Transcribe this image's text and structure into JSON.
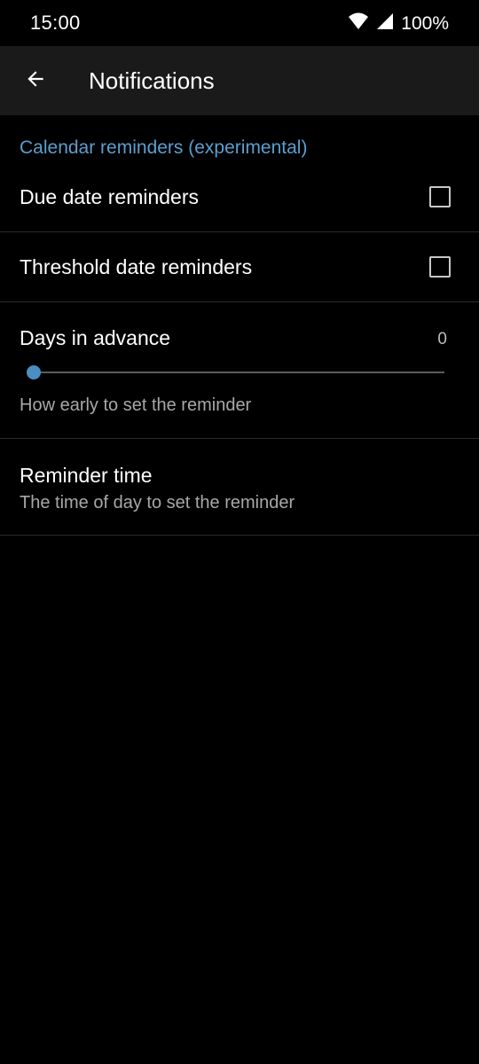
{
  "status_bar": {
    "time": "15:00",
    "battery": "100%",
    "icons": [
      "wifi-icon",
      "cell-signal-icon"
    ]
  },
  "app_bar": {
    "title": "Notifications",
    "back_icon": "arrow-left-icon"
  },
  "section": {
    "header": "Calendar reminders (experimental)"
  },
  "preferences": {
    "due_date": {
      "title": "Due date reminders",
      "checked": false
    },
    "threshold_date": {
      "title": "Threshold date reminders",
      "checked": false
    },
    "days_in_advance": {
      "title": "Days in advance",
      "value": "0",
      "summary": "How early to set the reminder",
      "slider_fraction": 0
    },
    "reminder_time": {
      "title": "Reminder time",
      "summary": "The time of day to set the reminder"
    }
  },
  "colors": {
    "accent": "#5a9fd0",
    "slider_thumb": "#4a8ec2",
    "background": "#000000",
    "app_bar": "#1a1a1a"
  }
}
